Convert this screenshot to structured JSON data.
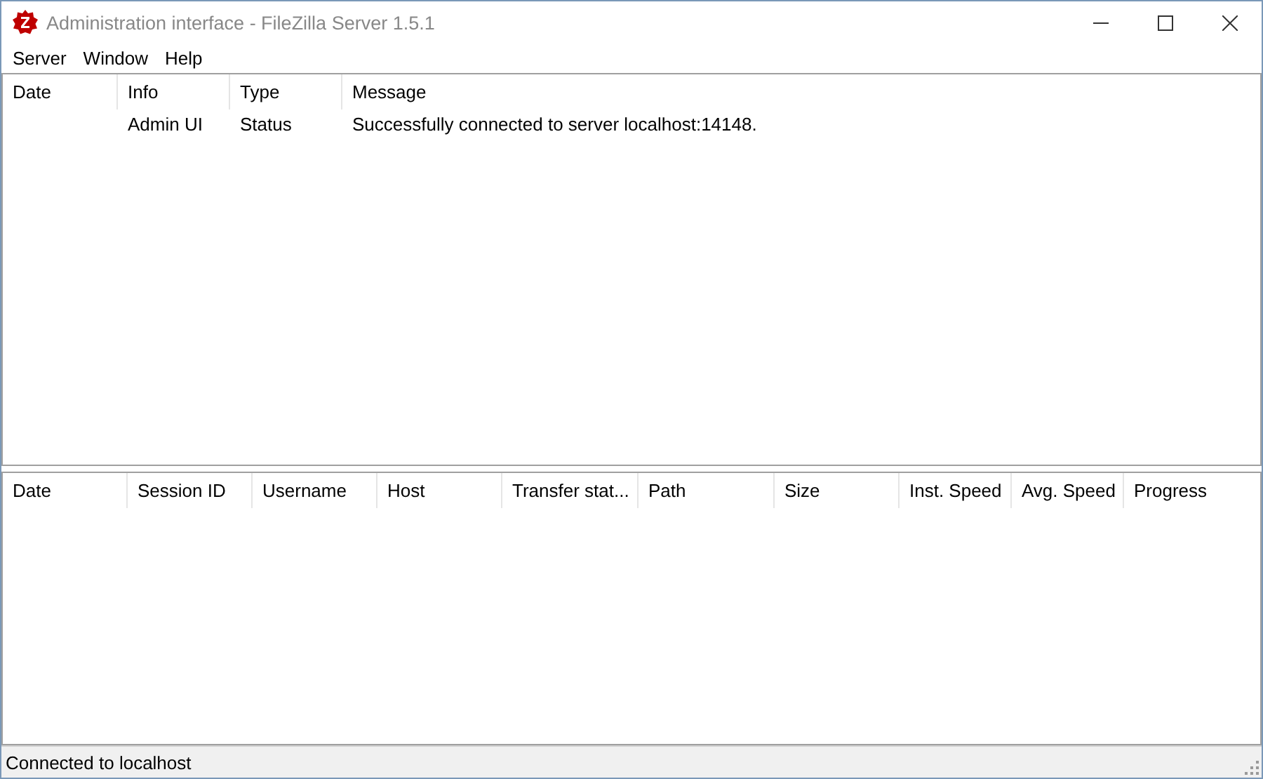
{
  "window": {
    "title": "Administration interface - FileZilla Server 1.5.1"
  },
  "menu": [
    "Server",
    "Window",
    "Help"
  ],
  "log": {
    "columns": [
      "Date",
      "Info",
      "Type",
      "Message"
    ],
    "rows": [
      [
        "",
        "Admin UI",
        "Status",
        "Successfully connected to server localhost:14148."
      ]
    ]
  },
  "transfers": {
    "columns": [
      "Date",
      "Session ID",
      "Username",
      "Host",
      "Transfer stat...",
      "Path",
      "Size",
      "Inst. Speed",
      "Avg. Speed",
      "Progress"
    ]
  },
  "status_bar": "Connected to localhost"
}
